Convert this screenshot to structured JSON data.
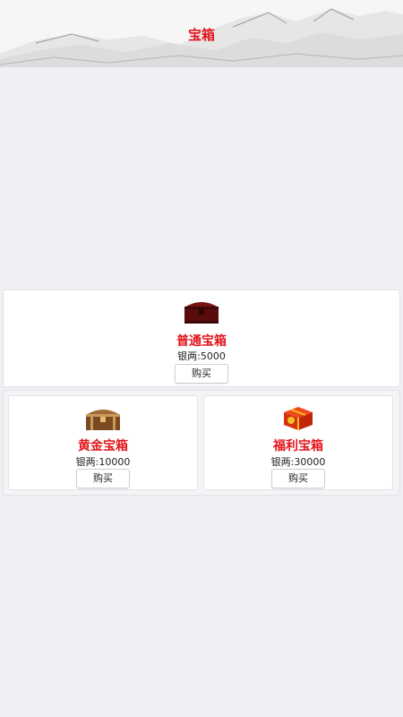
{
  "header": {
    "title": "宝箱"
  },
  "buy_label": "购买",
  "chests": [
    {
      "name": "普通宝箱",
      "price": "银两:5000",
      "icon": "red-chest-icon"
    },
    {
      "name": "黄金宝箱",
      "price": "银两:10000",
      "icon": "golden-chest-icon"
    },
    {
      "name": "福利宝箱",
      "price": "银两:30000",
      "icon": "gift-box-icon"
    }
  ],
  "colors": {
    "accent": "#e0161d",
    "background": "#efeff4"
  }
}
